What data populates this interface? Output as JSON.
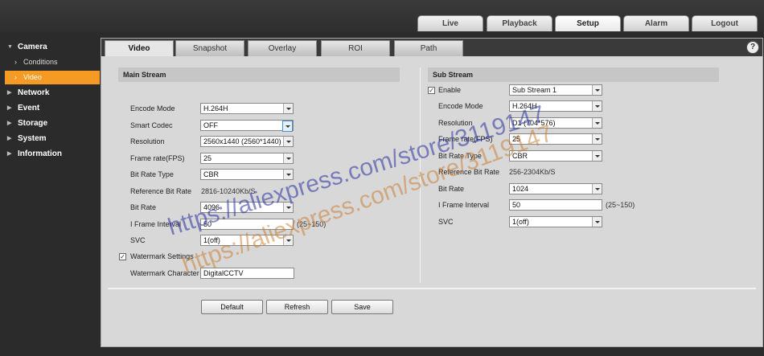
{
  "top_tabs": [
    {
      "label": "Live",
      "active": false
    },
    {
      "label": "Playback",
      "active": false
    },
    {
      "label": "Setup",
      "active": true
    },
    {
      "label": "Alarm",
      "active": false
    },
    {
      "label": "Logout",
      "active": false
    }
  ],
  "sidebar": {
    "camera": "Camera",
    "conditions": "Conditions",
    "video": "Video",
    "network": "Network",
    "event": "Event",
    "storage": "Storage",
    "system": "System",
    "information": "Information"
  },
  "sub_tabs": [
    "Video",
    "Snapshot",
    "Overlay",
    "ROI",
    "Path"
  ],
  "help_symbol": "?",
  "main_stream": {
    "title": "Main Stream",
    "encode_mode_label": "Encode Mode",
    "encode_mode": "H.264H",
    "smart_codec_label": "Smart Codec",
    "smart_codec": "OFF",
    "resolution_label": "Resolution",
    "resolution": "2560x1440 (2560*1440)",
    "frame_rate_label": "Frame rate(FPS)",
    "frame_rate": "25",
    "bit_rate_type_label": "Bit Rate Type",
    "bit_rate_type": "CBR",
    "ref_bit_rate_label": "Reference Bit Rate",
    "ref_bit_rate": "2816-10240Kb/S",
    "bit_rate_label": "Bit Rate",
    "bit_rate": "4096",
    "i_frame_label": "I Frame Interval",
    "i_frame": "50",
    "i_frame_range": "(25~150)",
    "svc_label": "SVC",
    "svc": "1(off)",
    "watermark_settings_label": "Watermark Settings",
    "watermark_char_label": "Watermark Character",
    "watermark_char": "DigitalCCTV"
  },
  "sub_stream": {
    "title": "Sub Stream",
    "enable_label": "Enable",
    "stream_select": "Sub Stream 1",
    "encode_mode_label": "Encode Mode",
    "encode_mode": "H.264H",
    "resolution_label": "Resolution",
    "resolution": "D1 (704*576)",
    "frame_rate_label": "Frame rate(FPS)",
    "frame_rate": "25",
    "bit_rate_type_label": "Bit Rate Type",
    "bit_rate_type": "CBR",
    "ref_bit_rate_label": "Reference Bit Rate",
    "ref_bit_rate": "256-2304Kb/S",
    "bit_rate_label": "Bit Rate",
    "bit_rate": "1024",
    "i_frame_label": "I Frame Interval",
    "i_frame": "50",
    "i_frame_range": "(25~150)",
    "svc_label": "SVC",
    "svc": "1(off)"
  },
  "buttons": {
    "default": "Default",
    "refresh": "Refresh",
    "save": "Save"
  },
  "watermark_text": "https://aliexpress.com/store/3119147"
}
